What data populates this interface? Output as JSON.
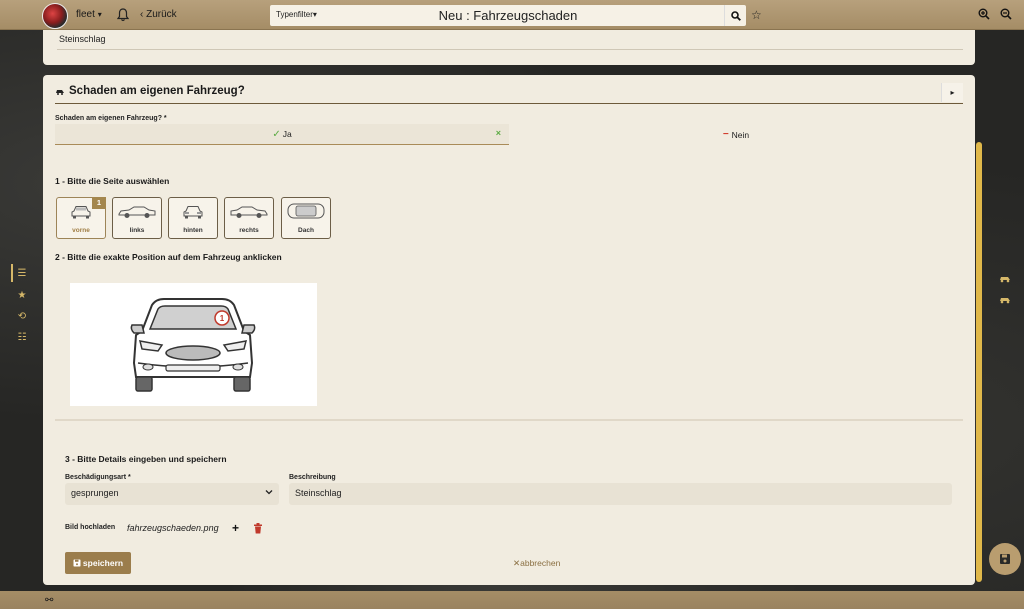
{
  "topbar": {
    "user_menu": "fleet",
    "back_label": "Zurück",
    "type_filter": "Typenfilter",
    "page_title": "Neu : Fahrzeugschaden"
  },
  "previous_field": {
    "value": "Steinschlag"
  },
  "section": {
    "title": "Schaden am eigenen Fahrzeug?",
    "question_label": "Schaden am eigenen Fahrzeug? *",
    "yes_label": "Ja",
    "no_label": "Nein",
    "yes_selected": true
  },
  "step1": {
    "title": "1 - Bitte die Seite auswählen",
    "sides": [
      {
        "label": "vorne",
        "badge": "1",
        "active": true
      },
      {
        "label": "links"
      },
      {
        "label": "hinten"
      },
      {
        "label": "rechts"
      },
      {
        "label": "Dach"
      }
    ]
  },
  "step2": {
    "title": "2 - Bitte die exakte Position auf dem Fahrzeug anklicken",
    "marker": "1"
  },
  "step3": {
    "title": "3 - Bitte Details eingeben und speichern",
    "damage_type_label": "Beschädigungsart *",
    "damage_type_value": "gesprungen",
    "description_label": "Beschreibung",
    "description_value": "Steinschlag",
    "upload_label": "Bild hochladen",
    "upload_filename": "fahrzeugschaeden.png"
  },
  "actions": {
    "save_label": "speichern",
    "cancel_label": "abbrechen"
  },
  "colors": {
    "accent": "#9b7d4c",
    "topbar": "#a58d66",
    "card": "#f1ece0",
    "scrollbar": "#e0b84a"
  }
}
